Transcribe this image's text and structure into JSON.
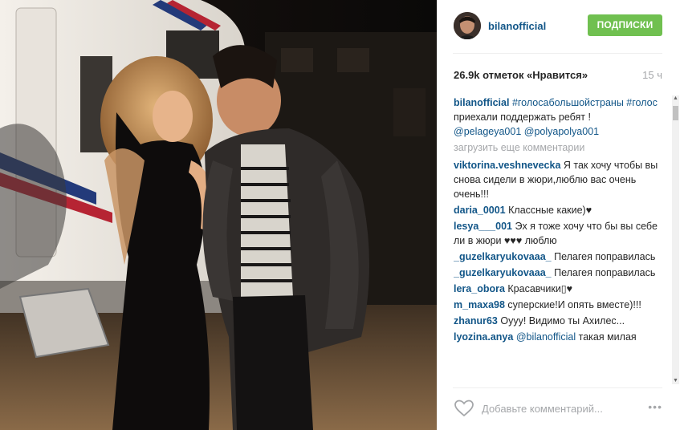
{
  "post": {
    "author": "bilanofficial",
    "follow_label": "ПОДПИСКИ",
    "likes_text": "26.9k отметок «Нравится»",
    "time_ago": "15 ч",
    "caption": {
      "user": "bilanofficial",
      "tag1": "#голосабольшойстраны",
      "tag2": "#голос",
      "text": " приехали поддержать ребят !",
      "mention1": "@pelageya001",
      "mention2": "@polyapolya001"
    },
    "load_more_label": "загрузить еще комментарии",
    "comments": [
      {
        "user": "viktorina.veshnevecka",
        "text": " Я так хочу чтобы вы снова сидели в жюри,люблю вас очень очень!!!"
      },
      {
        "user": "daria_0001",
        "text": " Классные какие)♥"
      },
      {
        "user": "lesya___001",
        "text": " Эх я тоже хочу что бы вы себе ли в жюри ♥♥♥ люблю"
      },
      {
        "user": "_guzelkaryukovaaa_",
        "text": "  Пелагея поправилась"
      },
      {
        "user": "_guzelkaryukovaaa_",
        "text": "  Пелагея поправилась"
      },
      {
        "user": "lera_obora",
        "text": " Красавчики▯♥"
      },
      {
        "user": "m_maxa98",
        "text": " суперские!И опять вместе)!!!"
      },
      {
        "user": "zhanur63",
        "text": " Оууу! Видимо ты Ахилес..."
      }
    ],
    "partial_comment": {
      "user": "lyozina.anya",
      "mention": "@bilanofficial",
      "text": " такая милая"
    },
    "add_comment_placeholder": "Добавьте комментарий...",
    "more_label": "•••",
    "icons": {
      "like": "heart-icon",
      "more": "more-options-icon",
      "avatar": "avatar"
    },
    "colors": {
      "link": "#125688",
      "follow": "#70c050",
      "muted": "#a5a7aa",
      "text": "#262626"
    }
  }
}
